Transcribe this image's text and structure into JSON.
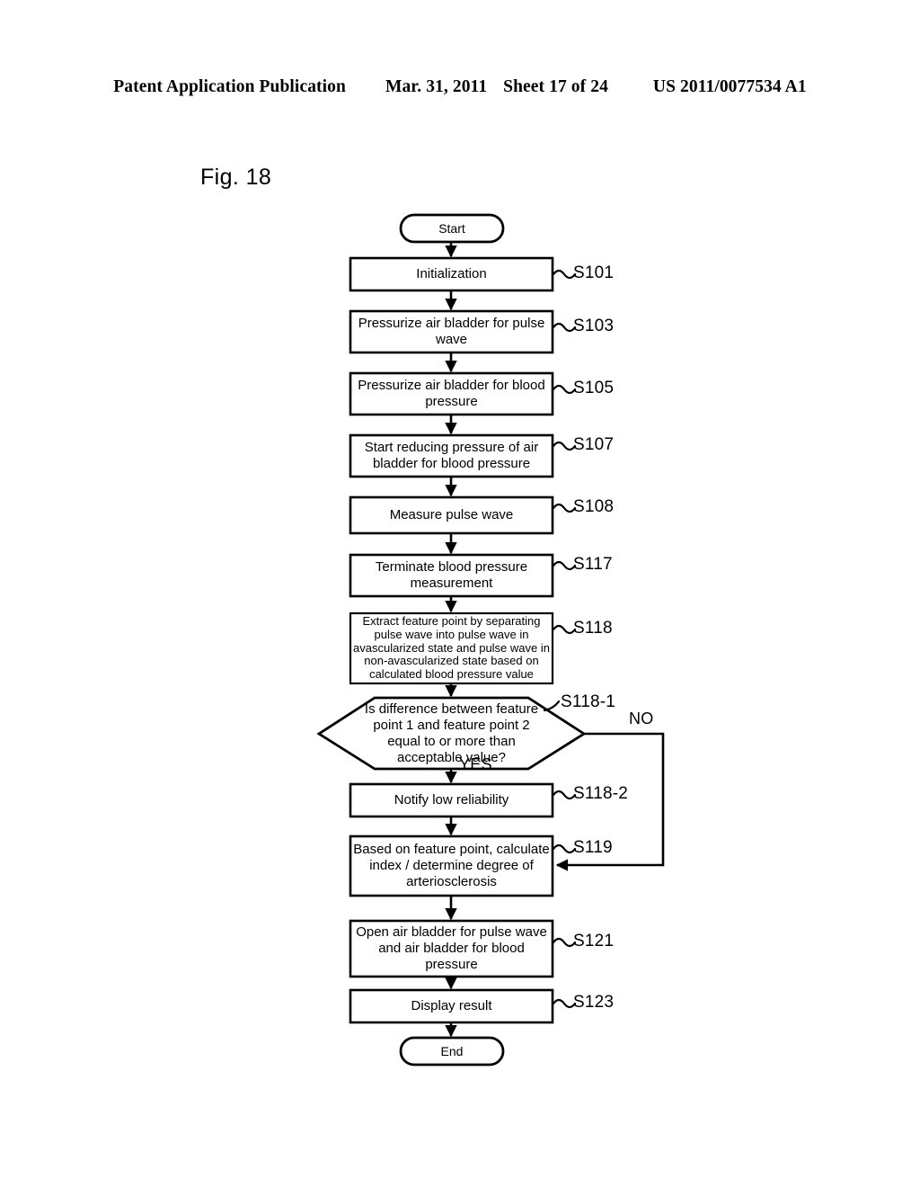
{
  "header": {
    "publication": "Patent Application Publication",
    "date": "Mar. 31, 2011",
    "sheet": "Sheet 17 of 24",
    "patent_number": "US 2011/0077534 A1"
  },
  "figure": {
    "label": "Fig. 18"
  },
  "flowchart": {
    "type": "flowchart",
    "orientation": "vertical",
    "start": {
      "text": "Start",
      "shape": "terminator"
    },
    "end": {
      "text": "End",
      "shape": "terminator"
    },
    "nodes": [
      {
        "id": "S101",
        "step": "S101",
        "shape": "process",
        "text": "Initialization",
        "lines": [
          "Initialization"
        ]
      },
      {
        "id": "S103",
        "step": "S103",
        "shape": "process",
        "text": "Pressurize air bladder for pulse wave",
        "lines": [
          "Pressurize air bladder for pulse",
          "wave"
        ]
      },
      {
        "id": "S105",
        "step": "S105",
        "shape": "process",
        "text": "Pressurize air bladder for blood pressure",
        "lines": [
          "Pressurize air bladder for blood",
          "pressure"
        ]
      },
      {
        "id": "S107",
        "step": "S107",
        "shape": "process",
        "text": "Start reducing pressure of air bladder for blood pressure",
        "lines": [
          "Start reducing pressure of air",
          "bladder for blood pressure"
        ]
      },
      {
        "id": "S108",
        "step": "S108",
        "shape": "process",
        "text": "Measure pulse wave",
        "lines": [
          "Measure pulse wave"
        ]
      },
      {
        "id": "S117",
        "step": "S117",
        "shape": "process",
        "text": "Terminate blood pressure measurement",
        "lines": [
          "Terminate blood pressure",
          "measurement"
        ]
      },
      {
        "id": "S118",
        "step": "S118",
        "shape": "process",
        "text": "Extract feature point by separating pulse wave into pulse wave in avascularized state and pulse wave in non-avascularized state based on calculated blood pressure value",
        "lines": [
          "Extract feature point by separating",
          "pulse wave into pulse wave in",
          "avascularized state and pulse wave in",
          "non-avascularized state based on",
          "calculated blood pressure value"
        ]
      },
      {
        "id": "S118-1",
        "step": "S118-1",
        "shape": "decision",
        "text": "Is difference between feature point 1 and feature point 2 equal to or more than acceptable value?",
        "lines": [
          "Is difference between feature",
          "point 1 and feature point 2 equal to",
          "or more than acceptable value?"
        ]
      },
      {
        "id": "S118-2",
        "step": "S118-2",
        "shape": "process",
        "text": "Notify low reliability",
        "lines": [
          "Notify low reliability"
        ]
      },
      {
        "id": "S119",
        "step": "S119",
        "shape": "process",
        "text": "Based on feature point, calculate index / determine degree of arteriosclerosis",
        "lines": [
          "Based on feature point, calculate",
          "index / determine degree of",
          "arteriosclerosis"
        ]
      },
      {
        "id": "S121",
        "step": "S121",
        "shape": "process",
        "text": "Open air bladder for pulse wave and air bladder for blood pressure",
        "lines": [
          "Open air bladder for pulse wave",
          "and air bladder for blood",
          "pressure"
        ]
      },
      {
        "id": "S123",
        "step": "S123",
        "shape": "process",
        "text": "Display result",
        "lines": [
          "Display result"
        ]
      }
    ],
    "branches": {
      "yes": "YES",
      "no": "NO"
    },
    "colors": {
      "line": "#000000",
      "background": "#ffffff",
      "text": "#000000"
    }
  }
}
